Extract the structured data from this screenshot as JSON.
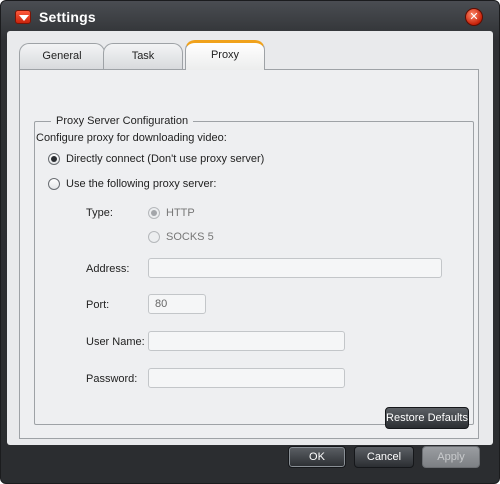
{
  "window": {
    "title": "Settings"
  },
  "tabs": [
    {
      "label": "General"
    },
    {
      "label": "Task"
    },
    {
      "label": "Proxy"
    }
  ],
  "proxy": {
    "group_title": "Proxy Server Configuration",
    "prompt": "Configure proxy for downloading video:",
    "option_direct": "Directly connect (Don't use proxy server)",
    "option_custom": "Use the following proxy server:",
    "type_label": "Type:",
    "type_http": "HTTP",
    "type_socks": "SOCKS 5",
    "address_label": "Address:",
    "address_value": "",
    "port_label": "Port:",
    "port_value": "80",
    "username_label": "User Name:",
    "username_value": "",
    "password_label": "Password:",
    "password_value": ""
  },
  "buttons": {
    "restore": "Restore Defaults",
    "ok": "OK",
    "cancel": "Cancel",
    "apply": "Apply"
  }
}
